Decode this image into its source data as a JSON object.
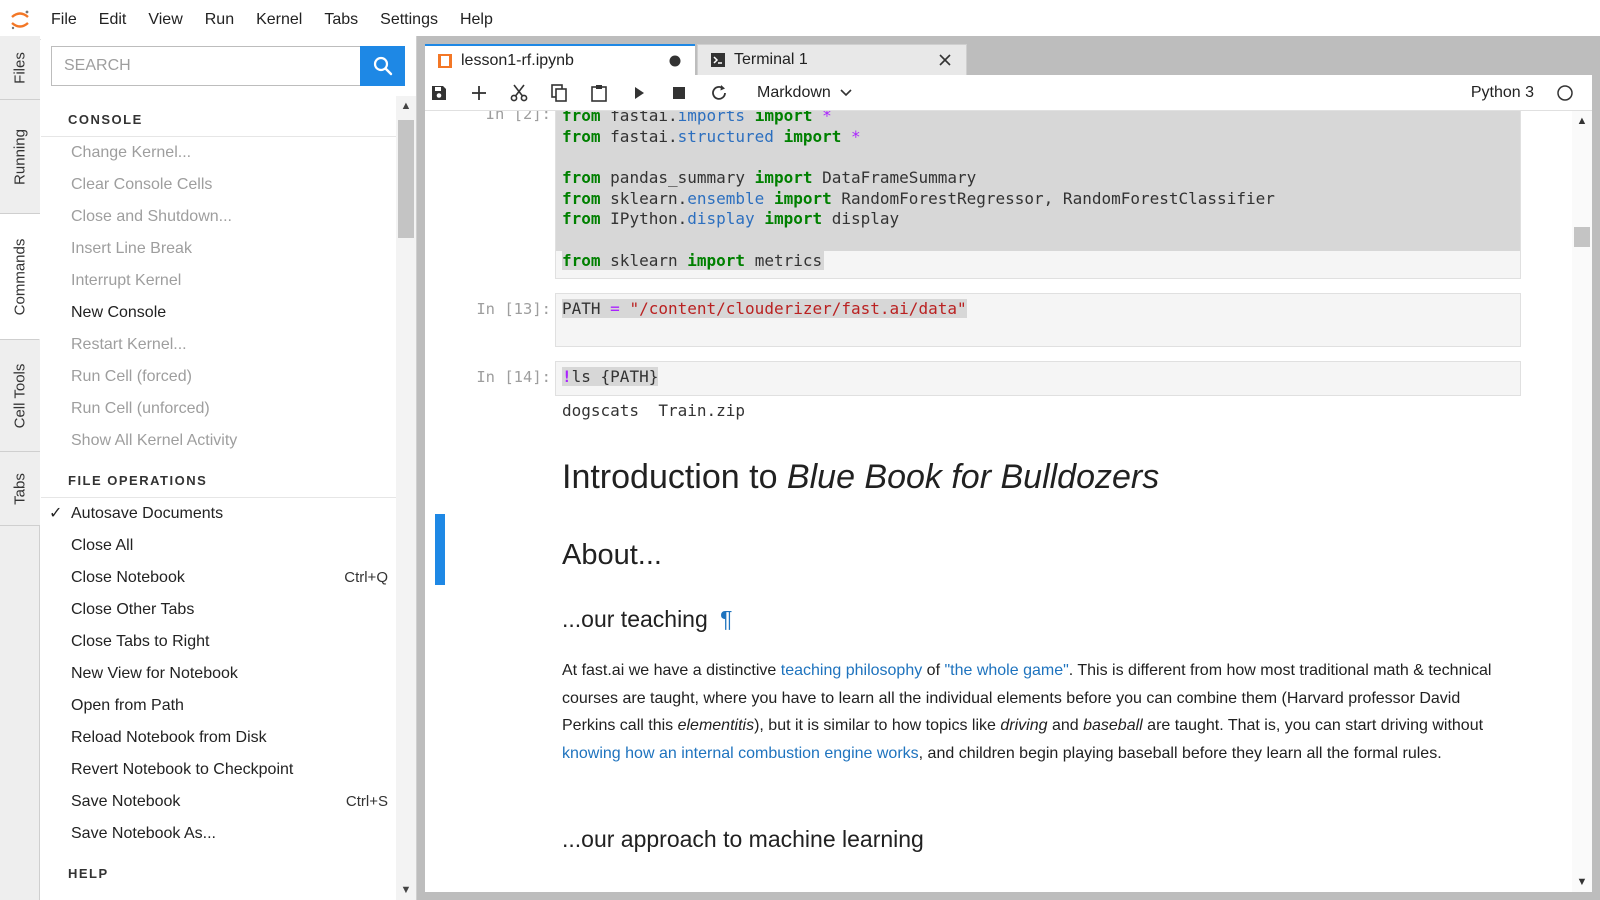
{
  "menubar": {
    "items": [
      "File",
      "Edit",
      "View",
      "Run",
      "Kernel",
      "Tabs",
      "Settings",
      "Help"
    ]
  },
  "left_tabs": [
    "Files",
    "Running",
    "Commands",
    "Cell Tools",
    "Tabs"
  ],
  "search": {
    "placeholder": "SEARCH"
  },
  "commands": {
    "console_header": "CONSOLE",
    "console_items": [
      "Change Kernel...",
      "Clear Console Cells",
      "Close and Shutdown...",
      "Insert Line Break",
      "Interrupt Kernel",
      "New Console",
      "Restart Kernel...",
      "Run Cell (forced)",
      "Run Cell (unforced)",
      "Show All Kernel Activity"
    ],
    "file_header": "FILE OPERATIONS",
    "file_items": [
      "Autosave Documents",
      "Close All",
      "Close Notebook",
      "Close Other Tabs",
      "Close Tabs to Right",
      "New View for Notebook",
      "Open from Path",
      "Reload Notebook from Disk",
      "Revert Notebook to Checkpoint",
      "Save Notebook",
      "Save Notebook As..."
    ],
    "close_notebook_shortcut": "Ctrl+Q",
    "save_notebook_shortcut": "Ctrl+S",
    "help_header": "HELP"
  },
  "tabs": {
    "notebook": "lesson1-rf.ipynb",
    "terminal": "Terminal 1"
  },
  "toolbar": {
    "cell_type": "Markdown",
    "kernel": "Python 3"
  },
  "cells": {
    "c1_prompt": "In [2]:",
    "c1": {
      "l1_kw": "from",
      "l1_a": "fastai.",
      "l1_mod": "imports",
      "l1_imp": "import",
      "l1_star": "*",
      "l2_kw": "from",
      "l2_a": "fastai.",
      "l2_mod": "structured",
      "l2_imp": "import",
      "l2_star": "*",
      "l4_kw": "from",
      "l4_a": "pandas_summary",
      "l4_imp": "import",
      "l4_b": "DataFrameSummary",
      "l5_kw": "from",
      "l5_a": "sklearn.",
      "l5_mod": "ensemble",
      "l5_imp": "import",
      "l5_b": "RandomForestRegressor, RandomForestClassifier",
      "l6_kw": "from",
      "l6_a": "IPython.",
      "l6_mod": "display",
      "l6_imp": "import",
      "l6_b": "display",
      "l8_kw": "from",
      "l8_a": "sklearn",
      "l8_imp": "import",
      "l8_b": "metrics"
    },
    "c2_prompt": "In [13]:",
    "c2": {
      "var": "PATH",
      "eq": "=",
      "str": "\"/content/clouderizer/fast.ai/data\""
    },
    "c3_prompt": "In [14]:",
    "c3": {
      "bang": "!",
      "cmd": "ls {PATH}"
    },
    "c3_output": "dogscats  Train.zip"
  },
  "markdown": {
    "h1_plain": "Introduction to ",
    "h1_italic": "Blue Book for Bulldozers",
    "h2": "About...",
    "h3_teaching": "...our teaching",
    "pilcrow": "¶",
    "p1_a": "At fast.ai we have a distinctive ",
    "p1_link1": "teaching philosophy",
    "p1_b": " of ",
    "p1_link2": "\"the whole game\"",
    "p1_c": ". This is different from how most traditional math & technical courses are taught, where you have to learn all the individual elements before you can combine them (Harvard professor David Perkins call this ",
    "p1_em1": "elementitis",
    "p1_d": "), but it is similar to how topics like ",
    "p1_em2": "driving",
    "p1_e": " and ",
    "p1_em3": "baseball",
    "p1_f": " are taught. That is, you can start driving without ",
    "p1_link3": "knowing how an internal combustion engine works",
    "p1_g": ", and children begin playing baseball before they learn all the formal rules.",
    "h3_approach": "...our approach to machine learning"
  },
  "colors": {
    "accent": "#1e88e5",
    "keyword": "#008000",
    "string": "#ba2121",
    "module": "#2c6fbf",
    "operator": "#aa22ff"
  }
}
